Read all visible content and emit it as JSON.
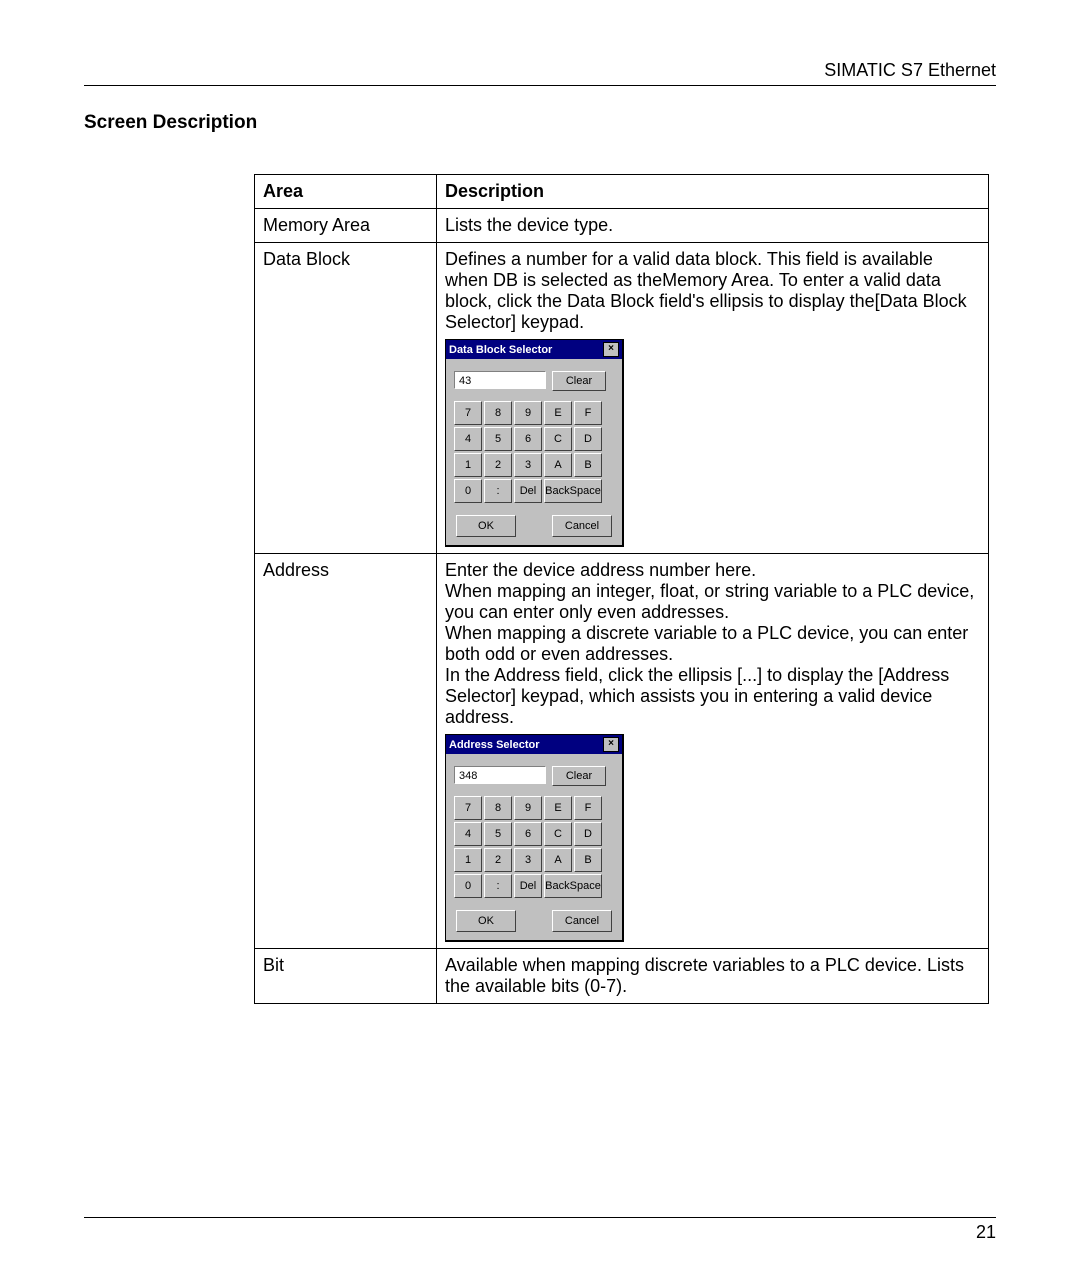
{
  "header": {
    "doc_title": "SIMATIC S7 Ethernet"
  },
  "section": {
    "title": "Screen Description"
  },
  "table": {
    "head": {
      "area": "Area",
      "desc": "Description"
    },
    "rows": {
      "memory_area": {
        "area": "Memory Area",
        "desc": "Lists the device type."
      },
      "data_block": {
        "area": "Data Block",
        "desc": "Defines a number for a valid data block. This field is available when DB is selected as theMemory Area. To enter a valid data block, click the Data Block field's ellipsis to display the[Data Block Selector] keypad."
      },
      "address": {
        "area": "Address",
        "desc": "Enter the device address number here.\nWhen mapping an integer, float, or string variable to a PLC device, you can enter only even addresses.\nWhen mapping a discrete variable to a PLC device, you can enter both odd or even addresses.\nIn the Address field, click the ellipsis [...] to display the [Address Selector] keypad, which assists you in entering a valid device address."
      },
      "bit": {
        "area": "Bit",
        "desc": "Available when mapping discrete variables to a PLC device. Lists the available bits (0-7)."
      }
    }
  },
  "dialog_db": {
    "title": "Data Block Selector",
    "value": "43",
    "clear": "Clear",
    "keys": [
      [
        "7",
        "8",
        "9",
        "E",
        "F"
      ],
      [
        "4",
        "5",
        "6",
        "C",
        "D"
      ],
      [
        "1",
        "2",
        "3",
        "A",
        "B"
      ],
      [
        "0",
        ":",
        "Del",
        "BackSpace"
      ]
    ],
    "ok": "OK",
    "cancel": "Cancel"
  },
  "dialog_addr": {
    "title": "Address Selector",
    "value": "348",
    "clear": "Clear",
    "keys": [
      [
        "7",
        "8",
        "9",
        "E",
        "F"
      ],
      [
        "4",
        "5",
        "6",
        "C",
        "D"
      ],
      [
        "1",
        "2",
        "3",
        "A",
        "B"
      ],
      [
        "0",
        ":",
        "Del",
        "BackSpace"
      ]
    ],
    "ok": "OK",
    "cancel": "Cancel"
  },
  "footer": {
    "page": "21"
  }
}
